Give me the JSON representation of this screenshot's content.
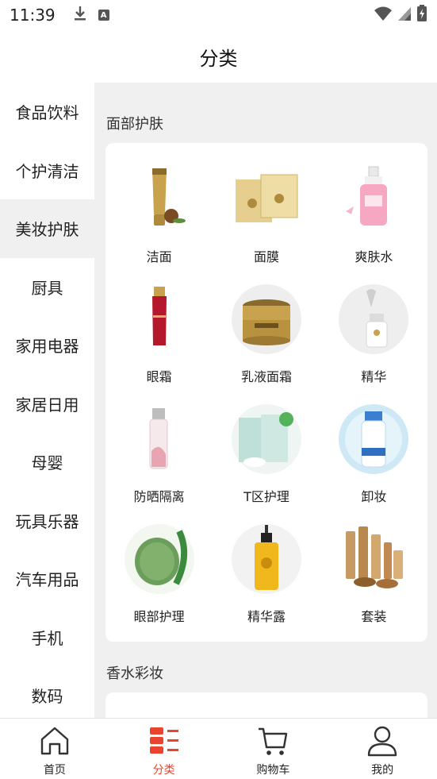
{
  "status_bar": {
    "time": "11:39",
    "badge_letter": "A"
  },
  "header": {
    "title": "分类"
  },
  "sidebar": {
    "items": [
      {
        "label": "食品饮料",
        "active": false
      },
      {
        "label": "个护清洁",
        "active": false
      },
      {
        "label": "美妆护肤",
        "active": true
      },
      {
        "label": "厨具",
        "active": false
      },
      {
        "label": "家用电器",
        "active": false
      },
      {
        "label": "家居日用",
        "active": false
      },
      {
        "label": "母婴",
        "active": false
      },
      {
        "label": "玩具乐器",
        "active": false
      },
      {
        "label": "汽车用品",
        "active": false
      },
      {
        "label": "手机",
        "active": false
      },
      {
        "label": "数码",
        "active": false
      }
    ]
  },
  "sections": [
    {
      "title": "面部护肤",
      "items": [
        {
          "label": "洁面",
          "icon": "cleanser-tube-icon"
        },
        {
          "label": "面膜",
          "icon": "face-mask-pack-icon"
        },
        {
          "label": "爽肤水",
          "icon": "toner-bottle-icon"
        },
        {
          "label": "眼霜",
          "icon": "eye-cream-tube-icon"
        },
        {
          "label": "乳液面霜",
          "icon": "cream-jar-icon"
        },
        {
          "label": "精华",
          "icon": "serum-dropper-icon"
        },
        {
          "label": "防晒隔离",
          "icon": "sunscreen-bottle-icon"
        },
        {
          "label": "T区护理",
          "icon": "nose-strip-pack-icon"
        },
        {
          "label": "卸妆",
          "icon": "makeup-remover-icon"
        },
        {
          "label": "眼部护理",
          "icon": "eye-patch-icon"
        },
        {
          "label": "精华露",
          "icon": "essence-bottle-icon"
        },
        {
          "label": "套装",
          "icon": "skincare-set-icon"
        }
      ]
    },
    {
      "title": "香水彩妆",
      "items": []
    }
  ],
  "bottom_nav": {
    "items": [
      {
        "label": "首页",
        "icon": "home-icon",
        "active": false
      },
      {
        "label": "分类",
        "icon": "category-icon",
        "active": true
      },
      {
        "label": "购物车",
        "icon": "cart-icon",
        "active": false
      },
      {
        "label": "我的",
        "icon": "profile-icon",
        "active": false
      }
    ]
  },
  "colors": {
    "accent": "#e8442f",
    "sidebar_active_bg": "#f0f0f0",
    "content_bg": "#f0f0f0"
  }
}
